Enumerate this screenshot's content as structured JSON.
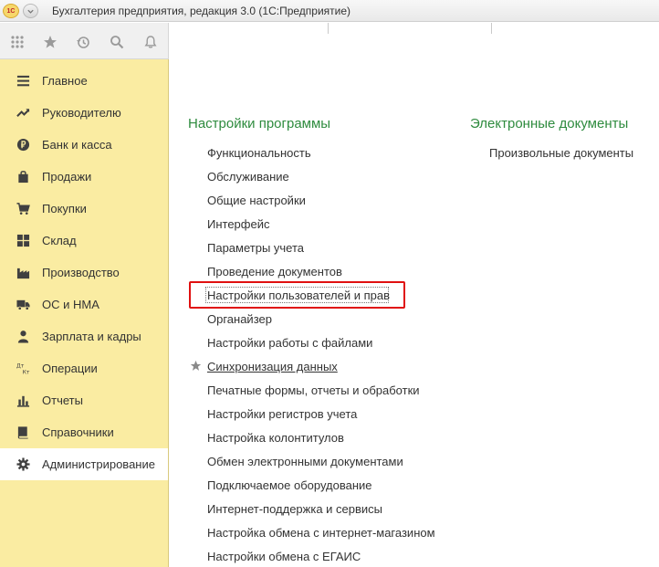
{
  "window": {
    "title": "Бухгалтерия предприятия, редакция 3.0  (1С:Предприятие)",
    "logo_text": "1С"
  },
  "toolbar": {
    "icons": [
      "apps-grid-icon",
      "star-icon",
      "history-icon",
      "search-icon",
      "bell-icon"
    ]
  },
  "sidebar": {
    "items": [
      {
        "label": "Главное",
        "icon": "menu-lines-icon"
      },
      {
        "label": "Руководителю",
        "icon": "trend-icon"
      },
      {
        "label": "Банк и касса",
        "icon": "ruble-coin-icon"
      },
      {
        "label": "Продажи",
        "icon": "shopping-bag-icon"
      },
      {
        "label": "Покупки",
        "icon": "cart-icon"
      },
      {
        "label": "Склад",
        "icon": "warehouse-grid-icon"
      },
      {
        "label": "Производство",
        "icon": "factory-icon"
      },
      {
        "label": "ОС и НМА",
        "icon": "truck-icon"
      },
      {
        "label": "Зарплата и кадры",
        "icon": "person-icon"
      },
      {
        "label": "Операции",
        "icon": "dt-kt-icon"
      },
      {
        "label": "Отчеты",
        "icon": "bar-chart-icon"
      },
      {
        "label": "Справочники",
        "icon": "book-icon"
      },
      {
        "label": "Администрирование",
        "icon": "gear-icon",
        "active": true
      }
    ],
    "dt_label": "Дт",
    "kt_label": "Кт"
  },
  "main": {
    "settings_title": "Настройки программы",
    "settings_links": [
      "Функциональность",
      "Обслуживание",
      "Общие настройки",
      "Интерфейс",
      "Параметры учета",
      "Проведение документов",
      "Настройки пользователей и прав",
      "Органайзер",
      "Настройки работы с файлами",
      "Синхронизация данных",
      "Печатные формы, отчеты и обработки",
      "Настройки регистров учета",
      "Настройка колонтитулов",
      "Обмен электронными документами",
      "Подключаемое оборудование",
      "Интернет-поддержка и сервисы",
      "Настройка обмена с интернет-магазином",
      "Настройки обмена с ЕГАИС"
    ],
    "edocs_title": "Электронные документы",
    "edocs_links": [
      "Произвольные документы"
    ]
  },
  "colors": {
    "sidebar_bg": "#faeca2",
    "section_title": "#2e8b3e",
    "highlight_border": "#e01010"
  }
}
